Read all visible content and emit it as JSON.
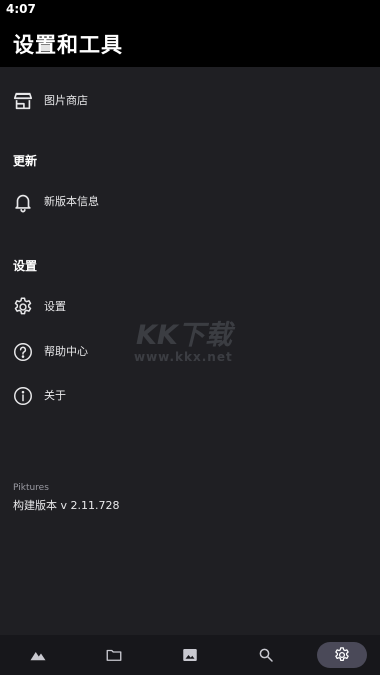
{
  "status_bar": {
    "time": "4:07"
  },
  "header": {
    "title": "设置和工具"
  },
  "menu": {
    "image_store": "图片商店",
    "section_update": "更新",
    "whats_new": "新版本信息",
    "section_settings": "设置",
    "settings": "设置",
    "help": "帮助中心",
    "about": "关于"
  },
  "footer": {
    "app_name": "Piktures",
    "build_version": "构建版本 v 2.11.728"
  },
  "watermark": {
    "logo": "KK下载",
    "url": "www.kkx.net"
  },
  "bottom_nav": {
    "items": [
      {
        "icon": "mountain-icon",
        "active": false
      },
      {
        "icon": "folder-icon",
        "active": false
      },
      {
        "icon": "image-icon",
        "active": false
      },
      {
        "icon": "search-icon",
        "active": false
      },
      {
        "icon": "gear-icon",
        "active": true
      }
    ]
  },
  "colors": {
    "background": "#1f1f23",
    "app_bar": "#000000",
    "nav_bar": "#17171b",
    "active_pill": "#4a4958",
    "text_primary": "#ffffff",
    "text_secondary": "#9a9aa2"
  }
}
